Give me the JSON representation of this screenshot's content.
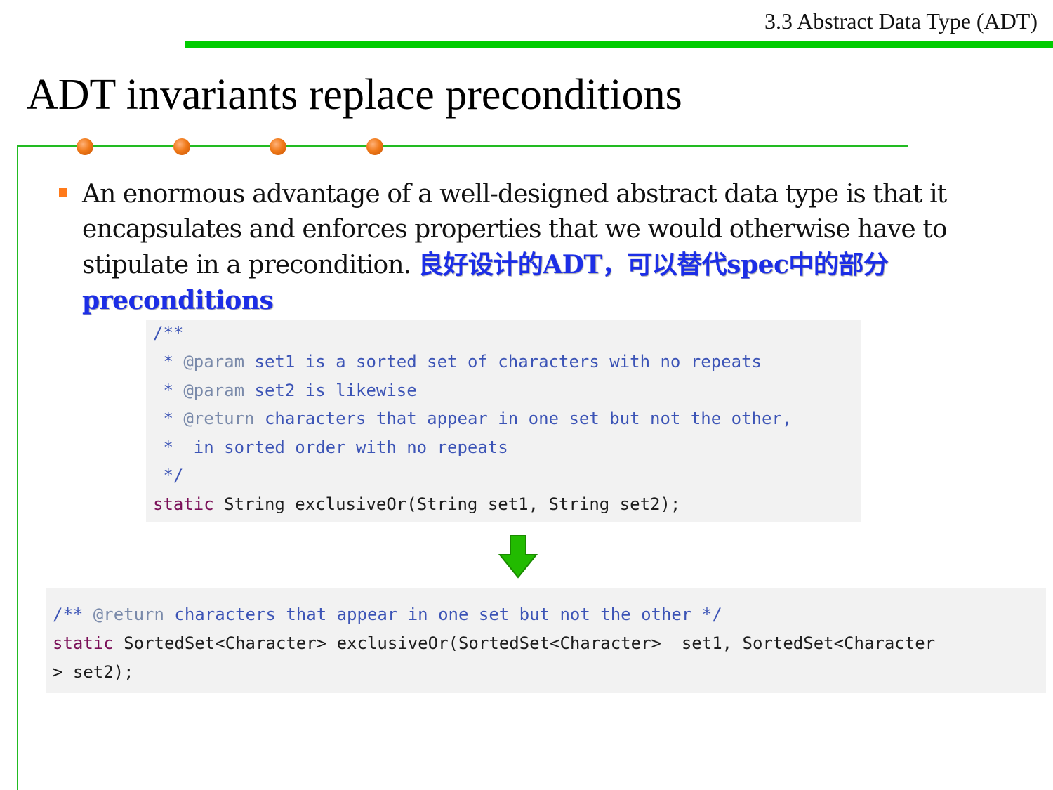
{
  "header": {
    "section_label": "3.3 Abstract Data Type (ADT)",
    "accent_color": "#00cc00"
  },
  "slide": {
    "title": "ADT invariants replace preconditions",
    "bullet": {
      "text_en": "An enormous advantage of a well-designed abstract data type is that it encapsulates and enforces properties that we would otherwise have to stipulate in a precondition.",
      "text_cn": "良好设计的ADT，可以替代spec中的部分preconditions",
      "cn_color": "#1c2ee6"
    }
  },
  "code_before": {
    "lines": [
      {
        "c": "/**"
      },
      {
        "c": " * ",
        "t": "@param",
        "r": " set1 is a sorted set of characters with no repeats"
      },
      {
        "c": " * ",
        "t": "@param",
        "r": " set2 is likewise"
      },
      {
        "c": " * ",
        "t": "@return",
        "r": " characters that appear in one set but not the other,"
      },
      {
        "c": " *  in sorted order with no repeats"
      },
      {
        "c": " */"
      },
      {
        "k": "static",
        "x": " String exclusiveOr(String set1, String set2);"
      }
    ]
  },
  "code_after": {
    "lines": [
      {
        "c": "/** ",
        "t": "@return",
        "r": " characters that appear in one set but not the other */"
      },
      {
        "k": "static",
        "x": " SortedSet<Character> exclusiveOr(SortedSet<Character>  set1, SortedSet<Character"
      },
      {
        "x": "> set2);"
      }
    ]
  },
  "arrow": {
    "icon": "down-arrow-icon",
    "color": "#22bb00"
  }
}
